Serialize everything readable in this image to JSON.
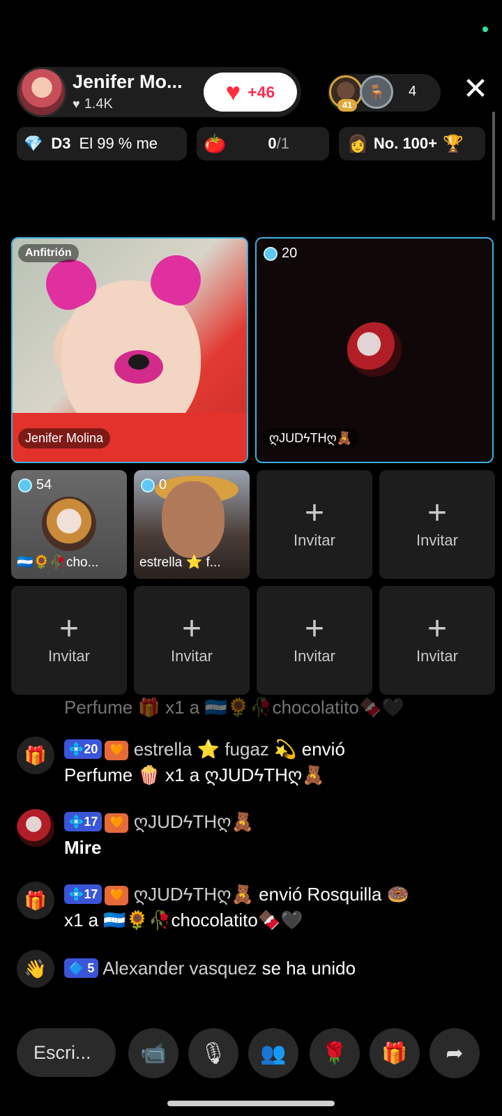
{
  "header": {
    "host_name": "Jenifer Mo...",
    "host_likes": "1.4K",
    "like_increment": "+46",
    "viewer_level_badge": "41",
    "viewer_count": "4",
    "close_symbol": "✕"
  },
  "chips": {
    "rank_level": "D3",
    "rank_text": "El 99 % me",
    "goal_progress": "0",
    "goal_total": "/1",
    "ranking": "No. 100+"
  },
  "grid": {
    "host_tag": "Anfitrión",
    "host_label": "Jenifer Molina",
    "guest_score": "20",
    "guest_label": "ღJUDϟTHღ🧸",
    "slot1_score": "54",
    "slot1_label": "🇭🇳🌻🥀cho...",
    "slot2_score": "0",
    "slot2_label": "estrella ⭐ f...",
    "invite_label": "Invitar",
    "invite_symbol": "+"
  },
  "chat": {
    "messages": [
      {
        "type": "gift",
        "text": "Perfume 🎁 x1 a 🇭🇳🌻🥀chocolatito🍫🖤"
      },
      {
        "type": "gift",
        "level": "20",
        "user": "estrella ⭐ fugaz 💫",
        "action": "envió",
        "text": "Perfume 🍿 x1 a ღJUDϟTHღ🧸"
      },
      {
        "type": "comment",
        "level": "17",
        "user": "ღJUDϟTHღ🧸",
        "text": "Mire"
      },
      {
        "type": "gift",
        "level": "17",
        "user": "ღJUDϟTHღ🧸",
        "action": "envió Rosquilla 🍩",
        "text": "x1 a 🇭🇳🌻🥀chocolatito🍫🖤"
      },
      {
        "type": "join",
        "level": "5",
        "user": "Alexander vasquez",
        "action": "se ha unido"
      }
    ]
  },
  "bottom_bar": {
    "input_placeholder": "Escri...",
    "icons": [
      "video-camera-icon",
      "microphone-icon",
      "people-icon",
      "rose-icon",
      "gift-icon",
      "share-icon"
    ]
  },
  "colors": {
    "accent_border": "#3bb0e0",
    "like_heart": "#ff2d3b",
    "level_badge": "#3b55d9"
  }
}
